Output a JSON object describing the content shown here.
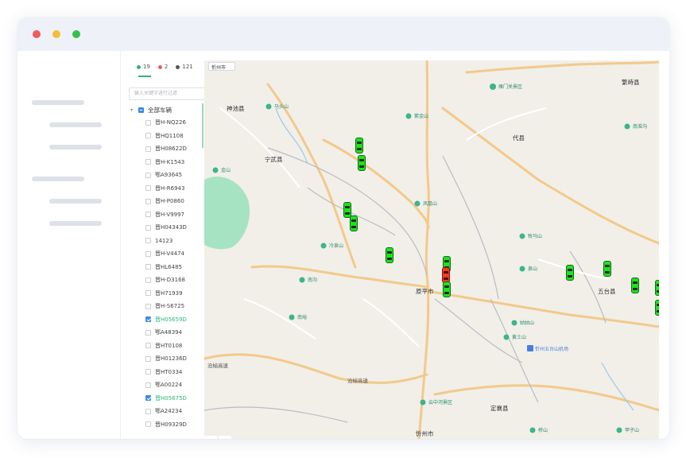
{
  "window": {
    "controls": [
      "close",
      "minimize",
      "maximize"
    ]
  },
  "stats": [
    {
      "count": "19",
      "color": "#2fb576"
    },
    {
      "count": "2",
      "color": "#f05c5c"
    },
    {
      "count": "121",
      "color": "#555555"
    }
  ],
  "search": {
    "placeholder": "输入关键字进行过滤"
  },
  "tree": {
    "root_label": "全部车辆",
    "items": [
      {
        "label": "晋H-NQ226",
        "checked": false
      },
      {
        "label": "晋HQ1108",
        "checked": false
      },
      {
        "label": "晋H08622D",
        "checked": false
      },
      {
        "label": "晋H-K1543",
        "checked": false
      },
      {
        "label": "鄂A93645",
        "checked": false
      },
      {
        "label": "晋H-R6943",
        "checked": false
      },
      {
        "label": "晋H-P0860",
        "checked": false
      },
      {
        "label": "晋H-V9997",
        "checked": false
      },
      {
        "label": "晋H04343D",
        "checked": false
      },
      {
        "label": "14123",
        "checked": false
      },
      {
        "label": "晋H-V4474",
        "checked": false
      },
      {
        "label": "晋HL6485",
        "checked": false
      },
      {
        "label": "晋H-D3168",
        "checked": false
      },
      {
        "label": "晋H71939",
        "checked": false
      },
      {
        "label": "晋H-S6725",
        "checked": false
      },
      {
        "label": "晋H05659D",
        "checked": true
      },
      {
        "label": "鄂A48394",
        "checked": false
      },
      {
        "label": "晋HT0108",
        "checked": false
      },
      {
        "label": "晋H01236D",
        "checked": false
      },
      {
        "label": "晋HT0334",
        "checked": false
      },
      {
        "label": "鄂A00224",
        "checked": false
      },
      {
        "label": "晋H05675D",
        "checked": true
      },
      {
        "label": "鄂A24234",
        "checked": false
      },
      {
        "label": "晋H09329D",
        "checked": false
      }
    ]
  },
  "map": {
    "city_select": "忻州市",
    "bottom_tabs": [
      "",
      ""
    ],
    "labels": {
      "shenchi": "神池县",
      "ningwu": "宁武县",
      "daixian": "代县",
      "yuanping": "原平市",
      "wutai": "五台县",
      "xinzhou": "忻州市",
      "dingxiang": "定襄县",
      "fanzhi": "繁峙县",
      "yanmenguan": "雁门关景区",
      "wutaishan_airport": "忻州五台山机场",
      "yunzhonghe": "云中河景区",
      "luomasi": "马头山",
      "xiangyunshan": "紫金山",
      "jinshan": "金山",
      "fenghuangshan": "凤凰山",
      "lengshan": "冷泉山",
      "nanhu": "南沟",
      "tianlongshan": "天龙山",
      "gusongshan": "牧马山",
      "qiaoshan": "桥山",
      "nanyu": "南峪",
      "quanshan": "泉山",
      "luoyushan": "罗家寨",
      "xixiashan": "西林",
      "nanhuaishan": "南淮沟",
      "shuanglong": "双龙",
      "gushan": "姑姑山",
      "huangyashan": "黄土山",
      "jiashan": "甲子山",
      "cangyu": "沧榆高速",
      "liuhuang": "沧榆高速",
      "pingyin": "平营",
      "dingxiang_road": "定襄",
      "shitouzhai": "石头寨"
    }
  },
  "vehicles": [
    {
      "status": "online"
    },
    {
      "status": "online"
    },
    {
      "status": "online"
    },
    {
      "status": "online"
    },
    {
      "status": "online"
    },
    {
      "status": "online"
    },
    {
      "status": "alarm"
    },
    {
      "status": "online"
    },
    {
      "status": "online"
    },
    {
      "status": "online"
    },
    {
      "status": "online"
    },
    {
      "status": "online"
    },
    {
      "status": "online"
    },
    {
      "status": "online"
    }
  ]
}
